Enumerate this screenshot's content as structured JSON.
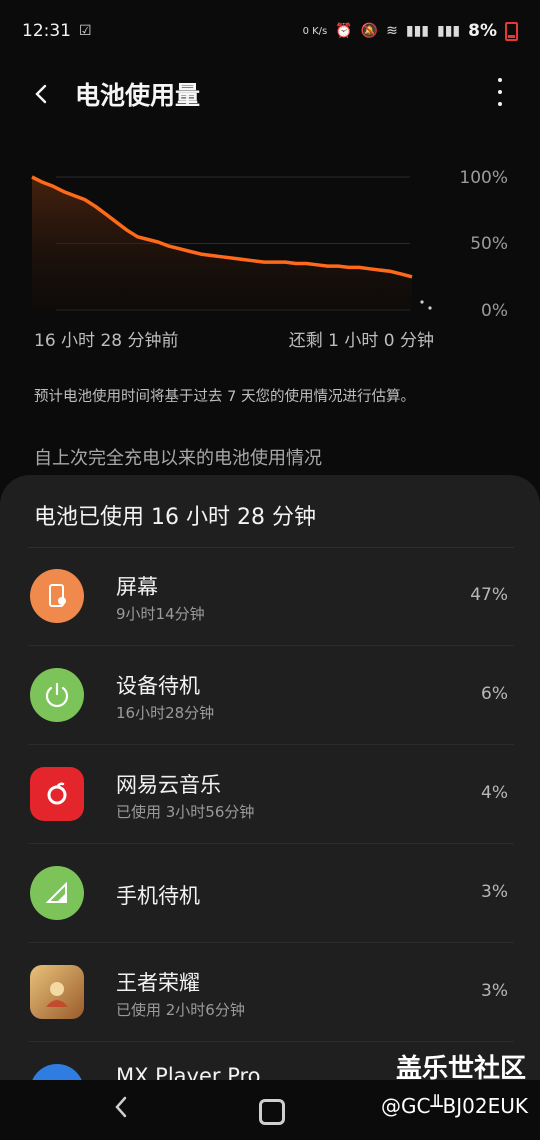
{
  "status": {
    "time": "12:31",
    "net_speed": "0 K/s",
    "battery_pct": "8%"
  },
  "appbar": {
    "title": "电池使用量"
  },
  "chart": {
    "y_labels": [
      "100%",
      "50%",
      "0%"
    ],
    "time_start": "16 小时 28 分钟前",
    "time_remaining": "还剩 1 小时 0 分钟",
    "accent": "#ff6a1a"
  },
  "chart_data": {
    "type": "area",
    "ylim": [
      0,
      100
    ],
    "series": [
      {
        "values": [
          100,
          96,
          93,
          89,
          86,
          83,
          78,
          72,
          66,
          60,
          55,
          53,
          51,
          48,
          46,
          44,
          42,
          41,
          40,
          39,
          38,
          37,
          36,
          36,
          36,
          35,
          35,
          34,
          33,
          33,
          32,
          32,
          31,
          30,
          29,
          27,
          25
        ]
      }
    ]
  },
  "estimate_note": "预计电池使用时间将基于过去 7 天您的使用情况进行估算。",
  "since_label": "自上次完全充电以来的电池使用情况",
  "sheet": {
    "title": "电池已使用 16 小时 28 分钟",
    "items": [
      {
        "name": "屏幕",
        "sub": "9小时14分钟",
        "pct": "47%",
        "icon": "screen-icon",
        "color": "#f0894c"
      },
      {
        "name": "设备待机",
        "sub": "16小时28分钟",
        "pct": "6%",
        "icon": "power-icon",
        "color": "#7cc35a"
      },
      {
        "name": "网易云音乐",
        "sub": "已使用 3小时56分钟",
        "pct": "4%",
        "icon": "netease-music-icon",
        "color": "#e4252b"
      },
      {
        "name": "手机待机",
        "sub": "",
        "pct": "3%",
        "icon": "signal-icon",
        "color": "#7cc35a"
      },
      {
        "name": "王者荣耀",
        "sub": "已使用 2小时6分钟",
        "pct": "3%",
        "icon": "game-icon",
        "color": "#c89a43"
      },
      {
        "name": "MX Player Pro",
        "sub": "",
        "pct": "",
        "icon": "play-icon",
        "color": "#2f7de1"
      }
    ]
  },
  "watermark": {
    "cn": "盖乐世社区",
    "en": "@GC╨BJ02EUK"
  }
}
